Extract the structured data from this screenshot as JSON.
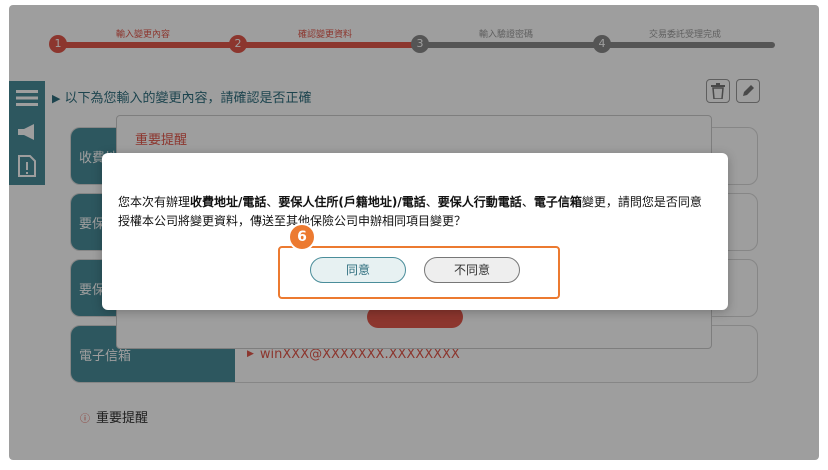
{
  "steps": [
    {
      "num": "1",
      "label": "輸入變更內容"
    },
    {
      "num": "2",
      "label": "確認變更資料"
    },
    {
      "num": "3",
      "label": "輸入驗證密碼"
    },
    {
      "num": "4",
      "label": "交易委託受理完成"
    }
  ],
  "intro_text": "以下為您輸入的變更內容，請確認是否正確",
  "rows": [
    {
      "label": "收費地",
      "value": ""
    },
    {
      "label": "要保人住址)",
      "value": ""
    },
    {
      "label": "要保",
      "value": ""
    },
    {
      "label": "電子信箱",
      "value": "winXXX@XXXXXXX.XXXXXXXX"
    }
  ],
  "footer_notice": "重要提醒",
  "bg_modal": {
    "title": "重要提醒"
  },
  "dialog": {
    "msg_prefix": "您本次有辦理",
    "bold1": "收費地址/電話",
    "sep1": "、",
    "bold2": "要保人住所(戶籍地址)/電話",
    "sep2": "、",
    "bold3": "要保人行動電話",
    "sep3": "、",
    "bold4": "電子信箱",
    "msg_mid": "變更，請問您是否同意",
    "msg_line2": "授權本公司將變更資料，傳送至其他保險公司申辦相同項目變更？",
    "agree_label": "同意",
    "disagree_label": "不同意"
  },
  "badge": "6",
  "colors": {
    "accent": "#e3574b",
    "teal": "#4a8d9a",
    "highlight": "#ec7a30"
  }
}
